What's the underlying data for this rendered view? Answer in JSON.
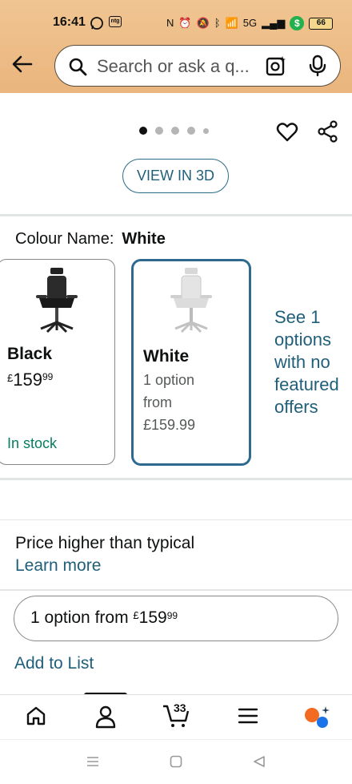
{
  "status_bar": {
    "time": "16:41",
    "battery": "66",
    "network": "5G"
  },
  "header": {
    "search_placeholder": "Search or ask a q...",
    "accent_color": "#eab57e"
  },
  "image_gallery": {
    "view_3d_label": "VIEW IN 3D",
    "dot_count": 5,
    "active_dot": 0
  },
  "colour": {
    "label": "Colour Name:",
    "selected": "White"
  },
  "swatches": [
    {
      "name": "Black",
      "currency": "£",
      "price_whole": "159",
      "price_fraction": "99",
      "stock": "In stock"
    },
    {
      "name": "White",
      "line1": "1 option",
      "line2": "from",
      "line3": "£159.99"
    }
  ],
  "see_options": {
    "lines": [
      "See 1",
      "options",
      "with no",
      "featured",
      "offers"
    ]
  },
  "pricing_note": {
    "text": "Price higher than typical",
    "link": "Learn more"
  },
  "option_button": {
    "prefix": "1 option from ",
    "currency": "£",
    "whole": "159",
    "fraction": "99"
  },
  "add_to_list": "Add to List",
  "bottom_nav": {
    "cart_count": "33",
    "items": [
      "home-icon",
      "account-icon",
      "cart-icon",
      "menu-icon",
      "rufus-icon"
    ]
  }
}
